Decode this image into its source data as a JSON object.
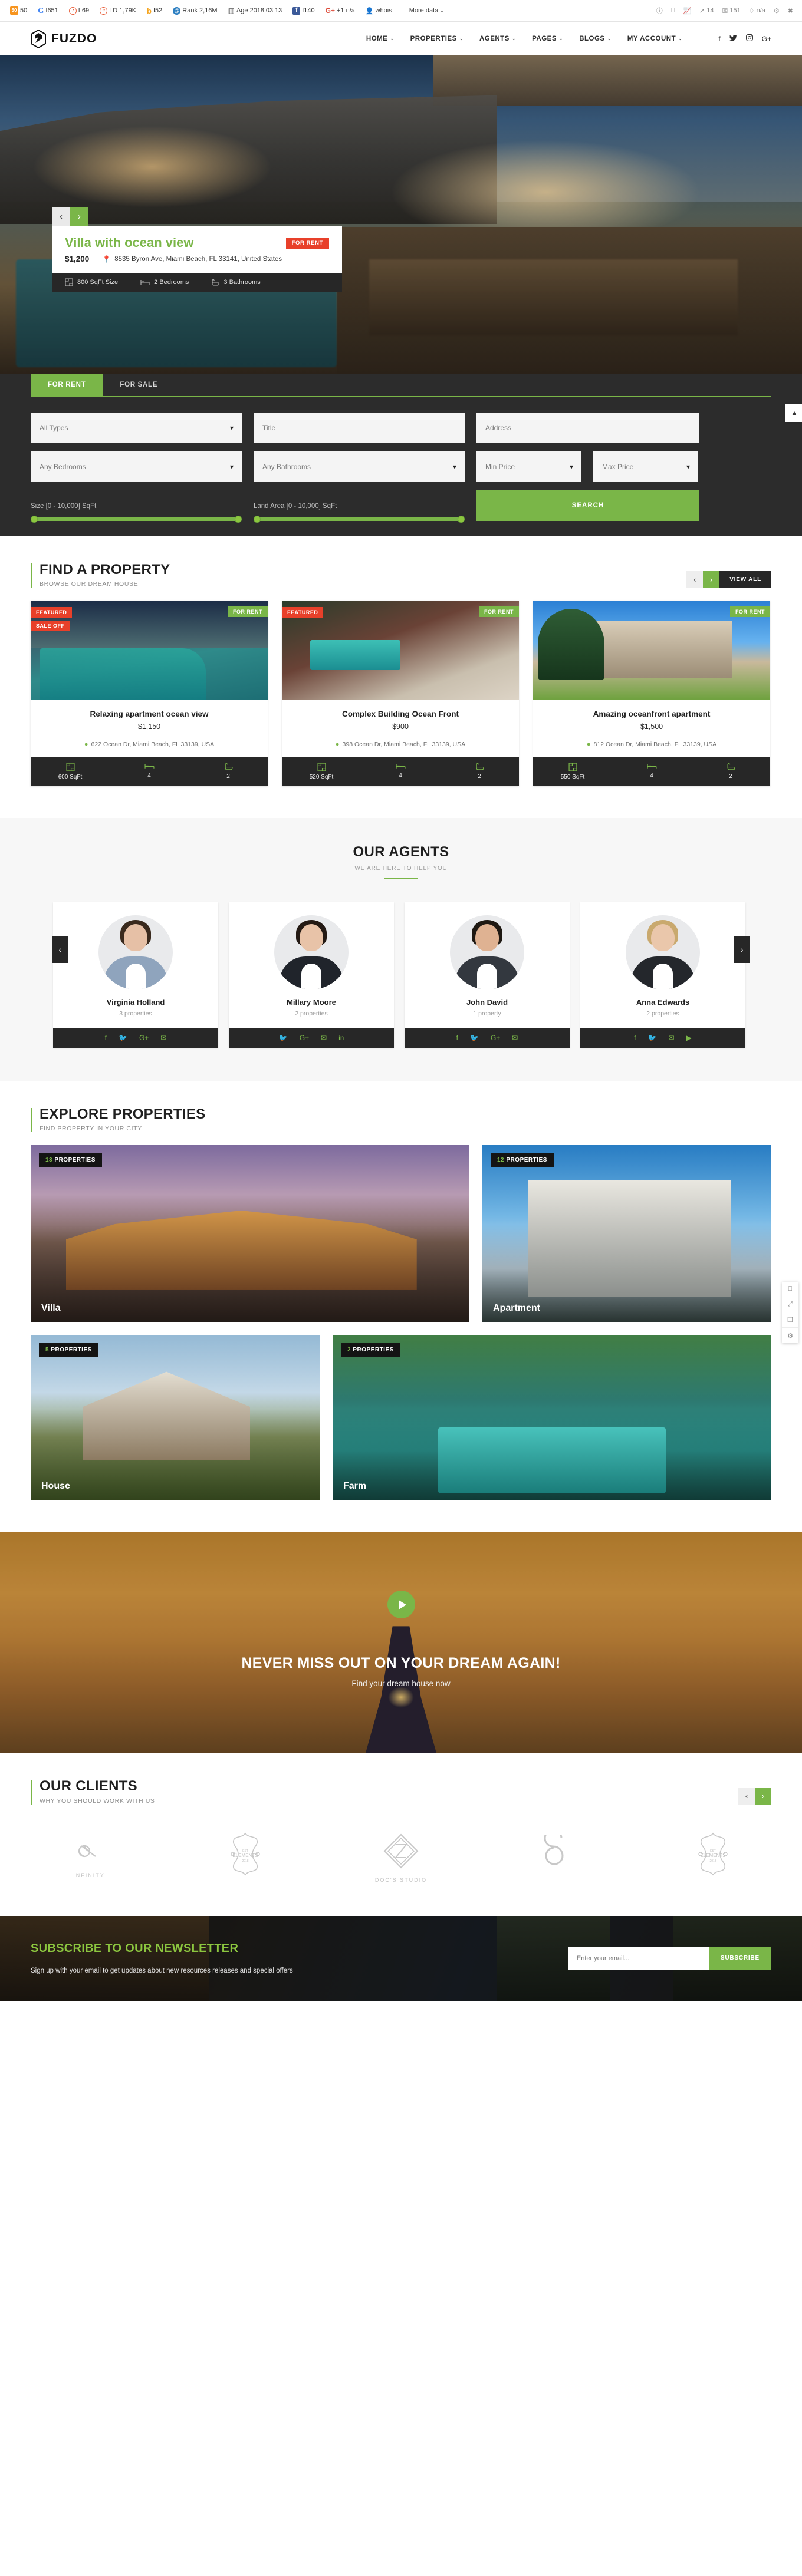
{
  "seo_bar": {
    "items": [
      {
        "icon": "moz-icon",
        "label": "50"
      },
      {
        "icon": "google-icon",
        "label": "I651"
      },
      {
        "icon": "open-site-explorer-icon",
        "label": "L69"
      },
      {
        "icon": "link-detective-icon",
        "label": "LD 1,79K"
      },
      {
        "icon": "bing-icon",
        "label": "I52"
      },
      {
        "icon": "alexa-icon",
        "label": "Rank 2,16M"
      },
      {
        "icon": "archive-icon",
        "label": "Age 2018|03|13"
      },
      {
        "icon": "facebook-icon",
        "label": "I140"
      },
      {
        "icon": "google-plus-icon",
        "label": "+1 n/a"
      },
      {
        "icon": "whois-icon",
        "label": "whois"
      }
    ],
    "more_label": "More data",
    "right_items": [
      {
        "icon": "info-icon",
        "label": ""
      },
      {
        "icon": "monitor-icon",
        "label": ""
      },
      {
        "icon": "chart-icon",
        "label": ""
      },
      {
        "icon": "external-link-icon",
        "label": "14"
      },
      {
        "icon": "check-square-icon",
        "label": "151"
      },
      {
        "icon": "diamond-icon",
        "label": "n/a"
      },
      {
        "icon": "gear-icon",
        "label": ""
      },
      {
        "icon": "close-icon",
        "label": ""
      }
    ]
  },
  "header": {
    "brand": "FUZDO",
    "nav": [
      {
        "label": "HOME",
        "has_caret": true
      },
      {
        "label": "PROPERTIES",
        "has_caret": true
      },
      {
        "label": "AGENTS",
        "has_caret": true
      },
      {
        "label": "PAGES",
        "has_caret": true
      },
      {
        "label": "BLOGS",
        "has_caret": true
      },
      {
        "label": "MY ACCOUNT",
        "has_caret": true
      }
    ],
    "social": [
      {
        "icon": "facebook-icon",
        "glyph": "f"
      },
      {
        "icon": "twitter-icon",
        "glyph": "🐦"
      },
      {
        "icon": "instagram-icon",
        "glyph": "◙"
      },
      {
        "icon": "google-plus-icon",
        "glyph": "G+"
      }
    ]
  },
  "hero": {
    "prev_label": "‹",
    "next_label": "›",
    "title": "Villa with ocean view",
    "badge": "FOR RENT",
    "price": "$1,200",
    "address": "8535 Byron Ave, Miami Beach, FL 33141, United States",
    "specs": [
      {
        "icon": "area-icon",
        "label": "800 SqFt Size"
      },
      {
        "icon": "bed-icon",
        "label": "2 Bedrooms"
      },
      {
        "icon": "bath-icon",
        "label": "3 Bathrooms"
      }
    ]
  },
  "search": {
    "tabs": [
      {
        "label": "FOR RENT",
        "active": true
      },
      {
        "label": "FOR SALE",
        "active": false
      }
    ],
    "toggle_icon": "chevron-up-icon",
    "type_value": "All Types",
    "title_placeholder": "Title",
    "address_placeholder": "Address",
    "bedrooms_value": "Any Bedrooms",
    "bathrooms_value": "Any Bathrooms",
    "min_price_value": "Min Price",
    "max_price_value": "Max Price",
    "size_label": "Size [0 - 10,000] SqFt",
    "land_label": "Land Area [0 - 10,000] SqFt",
    "search_button": "SEARCH"
  },
  "find_property": {
    "title": "FIND A PROPERTY",
    "subtitle": "BROWSE OUR DREAM HOUSE",
    "prev_label": "‹",
    "next_label": "›",
    "view_all": "VIEW ALL",
    "cards": [
      {
        "title": "Relaxing apartment ocean view",
        "price": "$1,150",
        "address": "622 Ocean Dr, Miami Beach, FL 33139, USA",
        "tags": [
          "FEATURED",
          "SALE OFF"
        ],
        "status": "FOR RENT",
        "size": "600 SqFt",
        "beds": "4",
        "baths": "2"
      },
      {
        "title": "Complex Building Ocean Front",
        "price": "$900",
        "address": "398 Ocean Dr, Miami Beach, FL 33139, USA",
        "tags": [
          "FEATURED"
        ],
        "status": "FOR RENT",
        "size": "520 SqFt",
        "beds": "4",
        "baths": "2"
      },
      {
        "title": "Amazing oceanfront apartment",
        "price": "$1,500",
        "address": "812 Ocean Dr, Miami Beach, FL 33139, USA",
        "tags": [],
        "status": "FOR RENT",
        "size": "550 SqFt",
        "beds": "4",
        "baths": "2"
      }
    ]
  },
  "agents": {
    "title": "OUR AGENTS",
    "subtitle": "WE ARE HERE TO HELP YOU",
    "prev_label": "‹",
    "next_label": "›",
    "list": [
      {
        "name": "Virginia Holland",
        "properties": "3 properties",
        "socials": [
          "facebook-icon",
          "twitter-icon",
          "google-plus-icon",
          "email-icon"
        ],
        "glyphs": [
          "f",
          "🐦",
          "G+",
          "✉"
        ],
        "hair": "#3a2a1e",
        "skin": "#e6c0a6",
        "suit": "#8fa4bd"
      },
      {
        "name": "Millary Moore",
        "properties": "2 properties",
        "socials": [
          "twitter-icon",
          "google-plus-icon",
          "email-icon",
          "linkedin-icon"
        ],
        "glyphs": [
          "🐦",
          "G+",
          "✉",
          "in"
        ],
        "hair": "#241a14",
        "skin": "#e8c3a8",
        "suit": "#20242b"
      },
      {
        "name": "John David",
        "properties": "1 property",
        "socials": [
          "facebook-icon",
          "twitter-icon",
          "google-plus-icon",
          "email-icon"
        ],
        "glyphs": [
          "f",
          "🐦",
          "G+",
          "✉"
        ],
        "hair": "#1f1913",
        "skin": "#dfb292",
        "suit": "#33383f"
      },
      {
        "name": "Anna Edwards",
        "properties": "2 properties",
        "socials": [
          "facebook-icon",
          "twitter-icon",
          "email-icon",
          "youtube-icon"
        ],
        "glyphs": [
          "f",
          "🐦",
          "✉",
          "▶"
        ],
        "hair": "#c9a košice",
        "skin": "#eac7ab",
        "suit": "#24272c"
      }
    ]
  },
  "explore": {
    "title": "EXPLORE PROPERTIES",
    "subtitle": "FIND PROPERTY IN YOUR CITY",
    "cards": [
      {
        "count": "13",
        "count_suffix": "PROPERTIES",
        "label": "Villa"
      },
      {
        "count": "12",
        "count_suffix": "PROPERTIES",
        "label": "Apartment"
      },
      {
        "count": "5",
        "count_suffix": "PROPERTIES",
        "label": "House"
      },
      {
        "count": "2",
        "count_suffix": "PROPERTIES",
        "label": "Farm"
      }
    ]
  },
  "cta": {
    "play_icon": "play-icon",
    "title": "NEVER MISS OUT ON YOUR DREAM AGAIN!",
    "subtitle": "Find your dream house now"
  },
  "clients": {
    "title": "OUR CLIENTS",
    "subtitle": "WHY YOU SHOULD WORK WITH US",
    "prev_label": "‹",
    "next_label": "›",
    "logos": [
      {
        "icon": "infinity-logo",
        "name": "INFINITY"
      },
      {
        "icon": "elements-logo",
        "name": ""
      },
      {
        "icon": "docs-studio-logo",
        "name": "DOC'S STUDIO"
      },
      {
        "icon": "connection-design-logo",
        "name": ""
      },
      {
        "icon": "elements-logo",
        "name": ""
      }
    ]
  },
  "newsletter": {
    "title": "SUBSCRIBE TO OUR NEWSLETTER",
    "subtitle": "Sign up with your email to get updates about new resources releases and special offers",
    "input_placeholder": "Enter your email...",
    "button": "SUBSCRIBE"
  },
  "float_tools": [
    {
      "icon": "monitor-icon",
      "glyph": "▭"
    },
    {
      "icon": "resize-icon",
      "glyph": "⇱"
    },
    {
      "icon": "copy-icon",
      "glyph": "❐"
    },
    {
      "icon": "settings-icon",
      "glyph": "⚙"
    }
  ],
  "colors": {
    "accent_green": "#7ab648",
    "accent_red": "#e8402a",
    "dark": "#272727",
    "panel_dark": "#2c2c2c"
  }
}
